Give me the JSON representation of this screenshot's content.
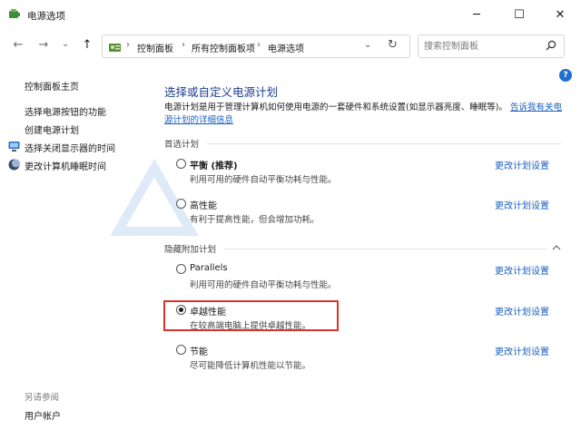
{
  "window": {
    "title": "电源选项",
    "controls": {
      "minimize": "─",
      "maximize": "☐",
      "close": "✕"
    }
  },
  "nav": {
    "back": "←",
    "forward": "→",
    "recent": "⌄",
    "up": "↑",
    "breadcrumbs": [
      "控制面板",
      "所有控制面板项",
      "电源选项"
    ],
    "separator": "›",
    "search_placeholder": "搜索控制面板"
  },
  "sidebar": {
    "home": "控制面板主页",
    "links": [
      "选择电源按钮的功能",
      "创建电源计划",
      "选择关闭显示器的时间",
      "更改计算机睡眠时间"
    ],
    "see_also_title": "另请参阅",
    "see_also_links": [
      "用户帐户"
    ]
  },
  "main": {
    "title": "选择或自定义电源计划",
    "desc_text": "电源计划是用于管理计算机如何使用电源的一套硬件和系统设置(如显示器亮度、睡眠等)。",
    "desc_link": "告诉我有关电源计划的详细信息",
    "preferred_group": "首选计划",
    "hidden_group": "隐藏附加计划",
    "plans": [
      {
        "name": "平衡",
        "suffix": " (推荐)",
        "desc": "利用可用的硬件自动平衡功耗与性能。",
        "checked": false,
        "link": "更改计划设置"
      },
      {
        "name": "高性能",
        "suffix": "",
        "desc": "有利于提高性能，但会增加功耗。",
        "checked": false,
        "link": "更改计划设置"
      },
      {
        "name": "Parallels",
        "suffix": "",
        "desc": "利用可用的硬件自动平衡功耗与性能。",
        "checked": false,
        "link": "更改计划设置"
      },
      {
        "name": "卓越性能",
        "suffix": "",
        "desc": "在较高端电脑上提供卓越性能。",
        "checked": true,
        "link": "更改计划设置"
      },
      {
        "name": "节能",
        "suffix": "",
        "desc": "尽可能降低计算机性能以节能。",
        "checked": false,
        "link": "更改计划设置"
      }
    ]
  },
  "colors": {
    "title_blue": "#1e3d8f",
    "link_blue": "#1a5fbf",
    "highlight_red": "#d9342b",
    "help_blue": "#1f6fd1"
  },
  "help": "?"
}
